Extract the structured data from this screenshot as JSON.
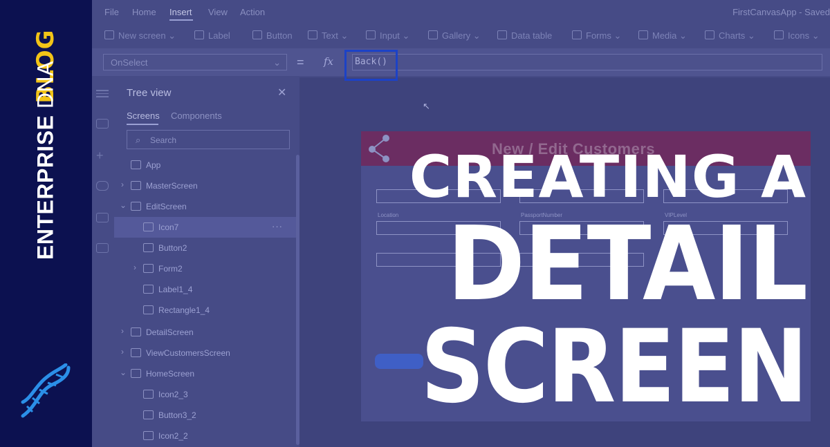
{
  "brand": {
    "enterprise": "ENTERPRISE",
    "dna": "DNA",
    "blog": "BLOG",
    "logo_icon": "dna-helix-icon",
    "colors": {
      "bar": "#0c1150",
      "accent": "#f2c417",
      "logo": "#2b8fe8"
    }
  },
  "headline": {
    "line1": "CREATING A",
    "line2": "DETAIL",
    "line3": "SCREEN"
  },
  "app": {
    "title": "FirstCanvasApp - Saved",
    "menu": [
      "File",
      "Home",
      "Insert",
      "View",
      "Action"
    ],
    "active_menu": "Insert",
    "toolbar": [
      "New screen",
      "Label",
      "Button",
      "Text",
      "Input",
      "Gallery",
      "Data table",
      "Forms",
      "Media",
      "Charts",
      "Icons"
    ],
    "formula": {
      "property": "OnSelect",
      "equals": "=",
      "fx": "fx",
      "value": "Back()",
      "highlight_color": "#1c42c6"
    },
    "tree_view": {
      "title": "Tree view",
      "tabs": [
        "Screens",
        "Components"
      ],
      "search_placeholder": "Search",
      "items": [
        {
          "label": "App",
          "icon": "app-icon"
        },
        {
          "label": "MasterScreen",
          "icon": "screen-icon"
        },
        {
          "label": "EditScreen",
          "icon": "screen-icon"
        },
        {
          "label": "Icon7",
          "icon": "icon-control-icon",
          "selected": true
        },
        {
          "label": "Button2",
          "icon": "button-icon"
        },
        {
          "label": "Form2",
          "icon": "form-icon"
        },
        {
          "label": "Label1_4",
          "icon": "label-icon"
        },
        {
          "label": "Rectangle1_4",
          "icon": "rectangle-icon"
        },
        {
          "label": "DetailScreen",
          "icon": "screen-icon"
        },
        {
          "label": "ViewCustomersScreen",
          "icon": "screen-icon"
        },
        {
          "label": "HomeScreen",
          "icon": "screen-icon"
        },
        {
          "label": "Icon2_3",
          "icon": "icon-control-icon"
        },
        {
          "label": "Button3_2",
          "icon": "button-icon"
        },
        {
          "label": "Icon2_2",
          "icon": "icon-control-icon"
        }
      ]
    },
    "canvas": {
      "form_title": "New / Edit Customers",
      "fields": [
        "Location",
        "PassportNumber",
        "VIPLevel"
      ],
      "header_color": "#6b2d62"
    }
  }
}
